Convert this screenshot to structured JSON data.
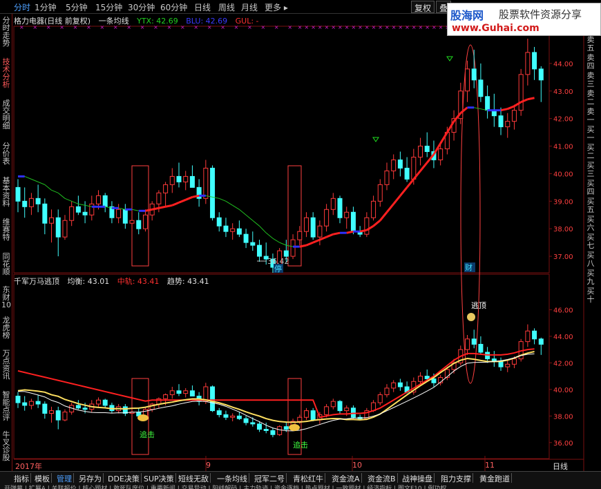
{
  "top_tabs": [
    {
      "label": "分时",
      "active": true
    },
    {
      "label": "1分钟"
    },
    {
      "label": "5分钟"
    },
    {
      "label": "15分钟"
    },
    {
      "label": "30分钟"
    },
    {
      "label": "60分钟"
    },
    {
      "label": "日线"
    },
    {
      "label": "周线"
    },
    {
      "label": "月线"
    },
    {
      "label": "更多 ▸"
    }
  ],
  "top_buttons": {
    "restore": "复权",
    "overlay": "叠"
  },
  "banner": {
    "logo": "股海网",
    "slogan": "股票软件资源分享",
    "url": "www.Guhai.com"
  },
  "left_tabs": [
    "分时走势",
    "技术分析",
    "成交明细",
    "分价表",
    "基本资料",
    "维赛特",
    "同花顺",
    "东财10",
    "龙虎榜",
    "万点资讯",
    "智能点评",
    "牛叉诊股"
  ],
  "main_info": {
    "stock": "格力电器(日线 前复权)",
    "indicator": "一条均线",
    "ytx": "YTX: 42.69",
    "blu": "BLU: 42.69",
    "gul": "GUL: -"
  },
  "sub_info": {
    "name": "千军万马逃顶",
    "balance": "均衡: 43.01",
    "middle": "中轨: 43.41",
    "trend": "趋势: 43.41"
  },
  "main_axis": [
    "44.00",
    "43.00",
    "42.00",
    "41.00",
    "40.00",
    "39.00",
    "38.00",
    "37.00"
  ],
  "sub_axis": [
    "46.00",
    "44.00",
    "42.00",
    "40.00",
    "38.00",
    "36.00"
  ],
  "right_strip": [
    "卖五",
    "卖四",
    "卖三",
    "卖二",
    "卖一",
    "买一",
    "买二",
    "买三",
    "买四",
    "买五",
    "买六",
    "买七",
    "买八",
    "买九",
    "买十"
  ],
  "annotations": {
    "low": "36.42",
    "stop": "停",
    "cai": "财",
    "escape": "逃顶",
    "chase1": "追击",
    "chase2": "追击"
  },
  "x_labels": {
    "year": "2017年",
    "m9": "9",
    "m10": "10",
    "m11": "11",
    "day": "日线"
  },
  "bottom_tabs": [
    "指标",
    "模板",
    "管理",
    "另存为",
    "DDE决策",
    "SUP决策",
    "短线无敌",
    "一条均线",
    "冠军二号",
    "青松红牛",
    "资金流A",
    "资金流B",
    "战神操盘",
    "阻力支撑",
    "黄金跑道"
  ],
  "bottom_row2": [
    "开弹幕",
    "扩展A",
    "关联报价",
    "核心题材",
    "敢死队席位",
    "重要新闻",
    "交易异动",
    "阳线解码",
    "主力轨迹",
    "资金逐档",
    "热点题材",
    "一致题材",
    "经济指标",
    "图文F10",
    "例功权"
  ],
  "colors": {
    "up": "#ff3a3a",
    "down": "#40ffff",
    "ma_red": "#ff2020",
    "ma_blue": "#3030ff",
    "ma_green": "#20c020",
    "balance": "#ffe060",
    "white": "#ffffff",
    "grid": "#7a1010"
  },
  "chart_data": {
    "type": "candlestick",
    "title": "格力电器(日线 前复权)",
    "ylim_main": [
      36.4,
      45
    ],
    "ylim_sub": [
      35,
      48
    ],
    "candles": [
      {
        "o": 39.5,
        "h": 39.8,
        "l": 38.6,
        "c": 39.0
      },
      {
        "o": 39.0,
        "h": 39.5,
        "l": 38.4,
        "c": 38.8
      },
      {
        "o": 38.8,
        "h": 39.3,
        "l": 38.5,
        "c": 39.1
      },
      {
        "o": 39.1,
        "h": 39.6,
        "l": 38.6,
        "c": 38.9
      },
      {
        "o": 38.9,
        "h": 39.1,
        "l": 37.8,
        "c": 38.2
      },
      {
        "o": 38.2,
        "h": 38.7,
        "l": 37.5,
        "c": 38.4
      },
      {
        "o": 38.4,
        "h": 38.7,
        "l": 37.0,
        "c": 37.7
      },
      {
        "o": 37.7,
        "h": 38.5,
        "l": 37.6,
        "c": 38.3
      },
      {
        "o": 38.3,
        "h": 39.0,
        "l": 38.1,
        "c": 38.8
      },
      {
        "o": 38.8,
        "h": 39.2,
        "l": 38.5,
        "c": 38.6
      },
      {
        "o": 38.6,
        "h": 39.0,
        "l": 38.2,
        "c": 38.5
      },
      {
        "o": 38.5,
        "h": 39.2,
        "l": 38.3,
        "c": 38.9
      },
      {
        "o": 38.9,
        "h": 39.4,
        "l": 38.7,
        "c": 39.2
      },
      {
        "o": 39.2,
        "h": 39.3,
        "l": 38.6,
        "c": 38.8
      },
      {
        "o": 38.8,
        "h": 39.0,
        "l": 38.2,
        "c": 38.4
      },
      {
        "o": 38.4,
        "h": 38.9,
        "l": 38.2,
        "c": 38.7
      },
      {
        "o": 38.7,
        "h": 38.9,
        "l": 38.0,
        "c": 38.2
      },
      {
        "o": 38.2,
        "h": 38.6,
        "l": 37.9,
        "c": 38.3
      },
      {
        "o": 38.3,
        "h": 38.6,
        "l": 37.8,
        "c": 38.0
      },
      {
        "o": 38.0,
        "h": 38.7,
        "l": 37.9,
        "c": 38.5
      },
      {
        "o": 38.5,
        "h": 39.0,
        "l": 38.3,
        "c": 38.9
      },
      {
        "o": 38.9,
        "h": 39.4,
        "l": 38.6,
        "c": 39.3
      },
      {
        "o": 39.3,
        "h": 39.7,
        "l": 38.8,
        "c": 39.6
      },
      {
        "o": 39.6,
        "h": 40.2,
        "l": 39.3,
        "c": 39.9
      },
      {
        "o": 39.9,
        "h": 40.4,
        "l": 39.5,
        "c": 39.7
      },
      {
        "o": 39.7,
        "h": 40.1,
        "l": 39.4,
        "c": 39.9
      },
      {
        "o": 39.9,
        "h": 40.3,
        "l": 39.5,
        "c": 39.5
      },
      {
        "o": 39.5,
        "h": 39.8,
        "l": 38.8,
        "c": 39.1
      },
      {
        "o": 39.1,
        "h": 40.5,
        "l": 38.9,
        "c": 40.2
      },
      {
        "o": 40.2,
        "h": 40.3,
        "l": 38.3,
        "c": 38.4
      },
      {
        "o": 38.4,
        "h": 38.6,
        "l": 37.9,
        "c": 38.1
      },
      {
        "o": 38.1,
        "h": 38.4,
        "l": 37.7,
        "c": 37.9
      },
      {
        "o": 37.9,
        "h": 38.2,
        "l": 37.6,
        "c": 38.0
      },
      {
        "o": 38.0,
        "h": 38.3,
        "l": 37.7,
        "c": 37.8
      },
      {
        "o": 37.8,
        "h": 38.0,
        "l": 37.3,
        "c": 37.5
      },
      {
        "o": 37.5,
        "h": 37.9,
        "l": 37.2,
        "c": 37.4
      },
      {
        "o": 37.4,
        "h": 37.6,
        "l": 36.8,
        "c": 37.0
      },
      {
        "o": 37.0,
        "h": 37.5,
        "l": 36.7,
        "c": 36.9
      },
      {
        "o": 36.9,
        "h": 37.1,
        "l": 36.4,
        "c": 36.6
      },
      {
        "o": 36.6,
        "h": 37.3,
        "l": 36.5,
        "c": 37.2
      },
      {
        "o": 37.2,
        "h": 37.6,
        "l": 36.8,
        "c": 37.0
      },
      {
        "o": 37.0,
        "h": 37.8,
        "l": 36.9,
        "c": 37.6
      },
      {
        "o": 37.6,
        "h": 38.1,
        "l": 37.4,
        "c": 37.9
      },
      {
        "o": 37.9,
        "h": 38.6,
        "l": 37.7,
        "c": 38.4
      },
      {
        "o": 38.4,
        "h": 38.6,
        "l": 37.6,
        "c": 37.7
      },
      {
        "o": 37.7,
        "h": 38.3,
        "l": 37.4,
        "c": 38.1
      },
      {
        "o": 38.1,
        "h": 38.9,
        "l": 37.9,
        "c": 38.7
      },
      {
        "o": 38.7,
        "h": 39.3,
        "l": 38.5,
        "c": 39.1
      },
      {
        "o": 39.1,
        "h": 39.2,
        "l": 38.2,
        "c": 38.4
      },
      {
        "o": 38.4,
        "h": 38.8,
        "l": 38.0,
        "c": 38.6
      },
      {
        "o": 38.6,
        "h": 38.8,
        "l": 37.8,
        "c": 37.9
      },
      {
        "o": 37.9,
        "h": 38.1,
        "l": 37.7,
        "c": 37.8
      },
      {
        "o": 37.8,
        "h": 38.6,
        "l": 37.7,
        "c": 38.4
      },
      {
        "o": 38.4,
        "h": 39.2,
        "l": 38.3,
        "c": 39.0
      },
      {
        "o": 39.0,
        "h": 39.8,
        "l": 38.8,
        "c": 39.6
      },
      {
        "o": 39.6,
        "h": 40.4,
        "l": 39.4,
        "c": 40.1
      },
      {
        "o": 40.1,
        "h": 40.7,
        "l": 39.8,
        "c": 40.5
      },
      {
        "o": 40.5,
        "h": 40.8,
        "l": 39.9,
        "c": 40.2
      },
      {
        "o": 40.2,
        "h": 40.6,
        "l": 39.7,
        "c": 39.8
      },
      {
        "o": 39.8,
        "h": 40.9,
        "l": 39.6,
        "c": 40.6
      },
      {
        "o": 40.6,
        "h": 41.3,
        "l": 40.3,
        "c": 41.0
      },
      {
        "o": 41.0,
        "h": 41.5,
        "l": 40.6,
        "c": 40.8
      },
      {
        "o": 40.8,
        "h": 41.2,
        "l": 40.2,
        "c": 40.5
      },
      {
        "o": 40.5,
        "h": 41.1,
        "l": 40.3,
        "c": 40.9
      },
      {
        "o": 40.9,
        "h": 41.7,
        "l": 40.7,
        "c": 41.5
      },
      {
        "o": 41.5,
        "h": 42.3,
        "l": 41.2,
        "c": 42.0
      },
      {
        "o": 42.0,
        "h": 43.3,
        "l": 41.8,
        "c": 43.0
      },
      {
        "o": 43.0,
        "h": 44.1,
        "l": 42.6,
        "c": 43.8
      },
      {
        "o": 43.8,
        "h": 44.5,
        "l": 43.1,
        "c": 43.4
      },
      {
        "o": 43.4,
        "h": 44.0,
        "l": 42.6,
        "c": 42.8
      },
      {
        "o": 42.8,
        "h": 43.2,
        "l": 42.0,
        "c": 42.3
      },
      {
        "o": 42.3,
        "h": 42.9,
        "l": 41.7,
        "c": 42.1
      },
      {
        "o": 42.1,
        "h": 42.4,
        "l": 41.4,
        "c": 41.7
      },
      {
        "o": 41.7,
        "h": 42.2,
        "l": 41.3,
        "c": 41.9
      },
      {
        "o": 41.9,
        "h": 42.5,
        "l": 41.6,
        "c": 42.3
      },
      {
        "o": 42.3,
        "h": 43.8,
        "l": 42.1,
        "c": 43.6
      },
      {
        "o": 43.6,
        "h": 44.9,
        "l": 43.2,
        "c": 44.4
      },
      {
        "o": 44.4,
        "h": 44.6,
        "l": 43.4,
        "c": 43.8
      },
      {
        "o": 43.8,
        "h": 43.9,
        "l": 42.6,
        "c": 43.4
      }
    ],
    "ma": [
      39.9,
      39.9,
      39.8,
      39.7,
      39.6,
      39.4,
      39.3,
      39.1,
      39.0,
      38.9,
      38.85,
      38.8,
      38.8,
      38.8,
      38.75,
      38.75,
      38.7,
      38.7,
      38.65,
      38.65,
      38.7,
      38.75,
      38.8,
      38.85,
      38.95,
      39.05,
      39.15,
      39.2,
      39.2,
      39.15,
      39.1,
      39.0,
      38.85,
      38.7,
      38.5,
      38.3,
      38.1,
      37.85,
      37.65,
      37.5,
      37.4,
      37.35,
      37.35,
      37.4,
      37.5,
      37.6,
      37.7,
      37.8,
      37.85,
      37.85,
      37.9,
      37.9,
      37.95,
      38.1,
      38.3,
      38.6,
      38.9,
      39.2,
      39.5,
      39.8,
      40.1,
      40.4,
      40.7,
      41.1,
      41.5,
      41.9,
      42.2,
      42.4,
      42.4,
      42.35,
      42.3,
      42.3,
      42.3,
      42.35,
      42.45,
      42.6,
      42.7,
      42.75
    ]
  }
}
